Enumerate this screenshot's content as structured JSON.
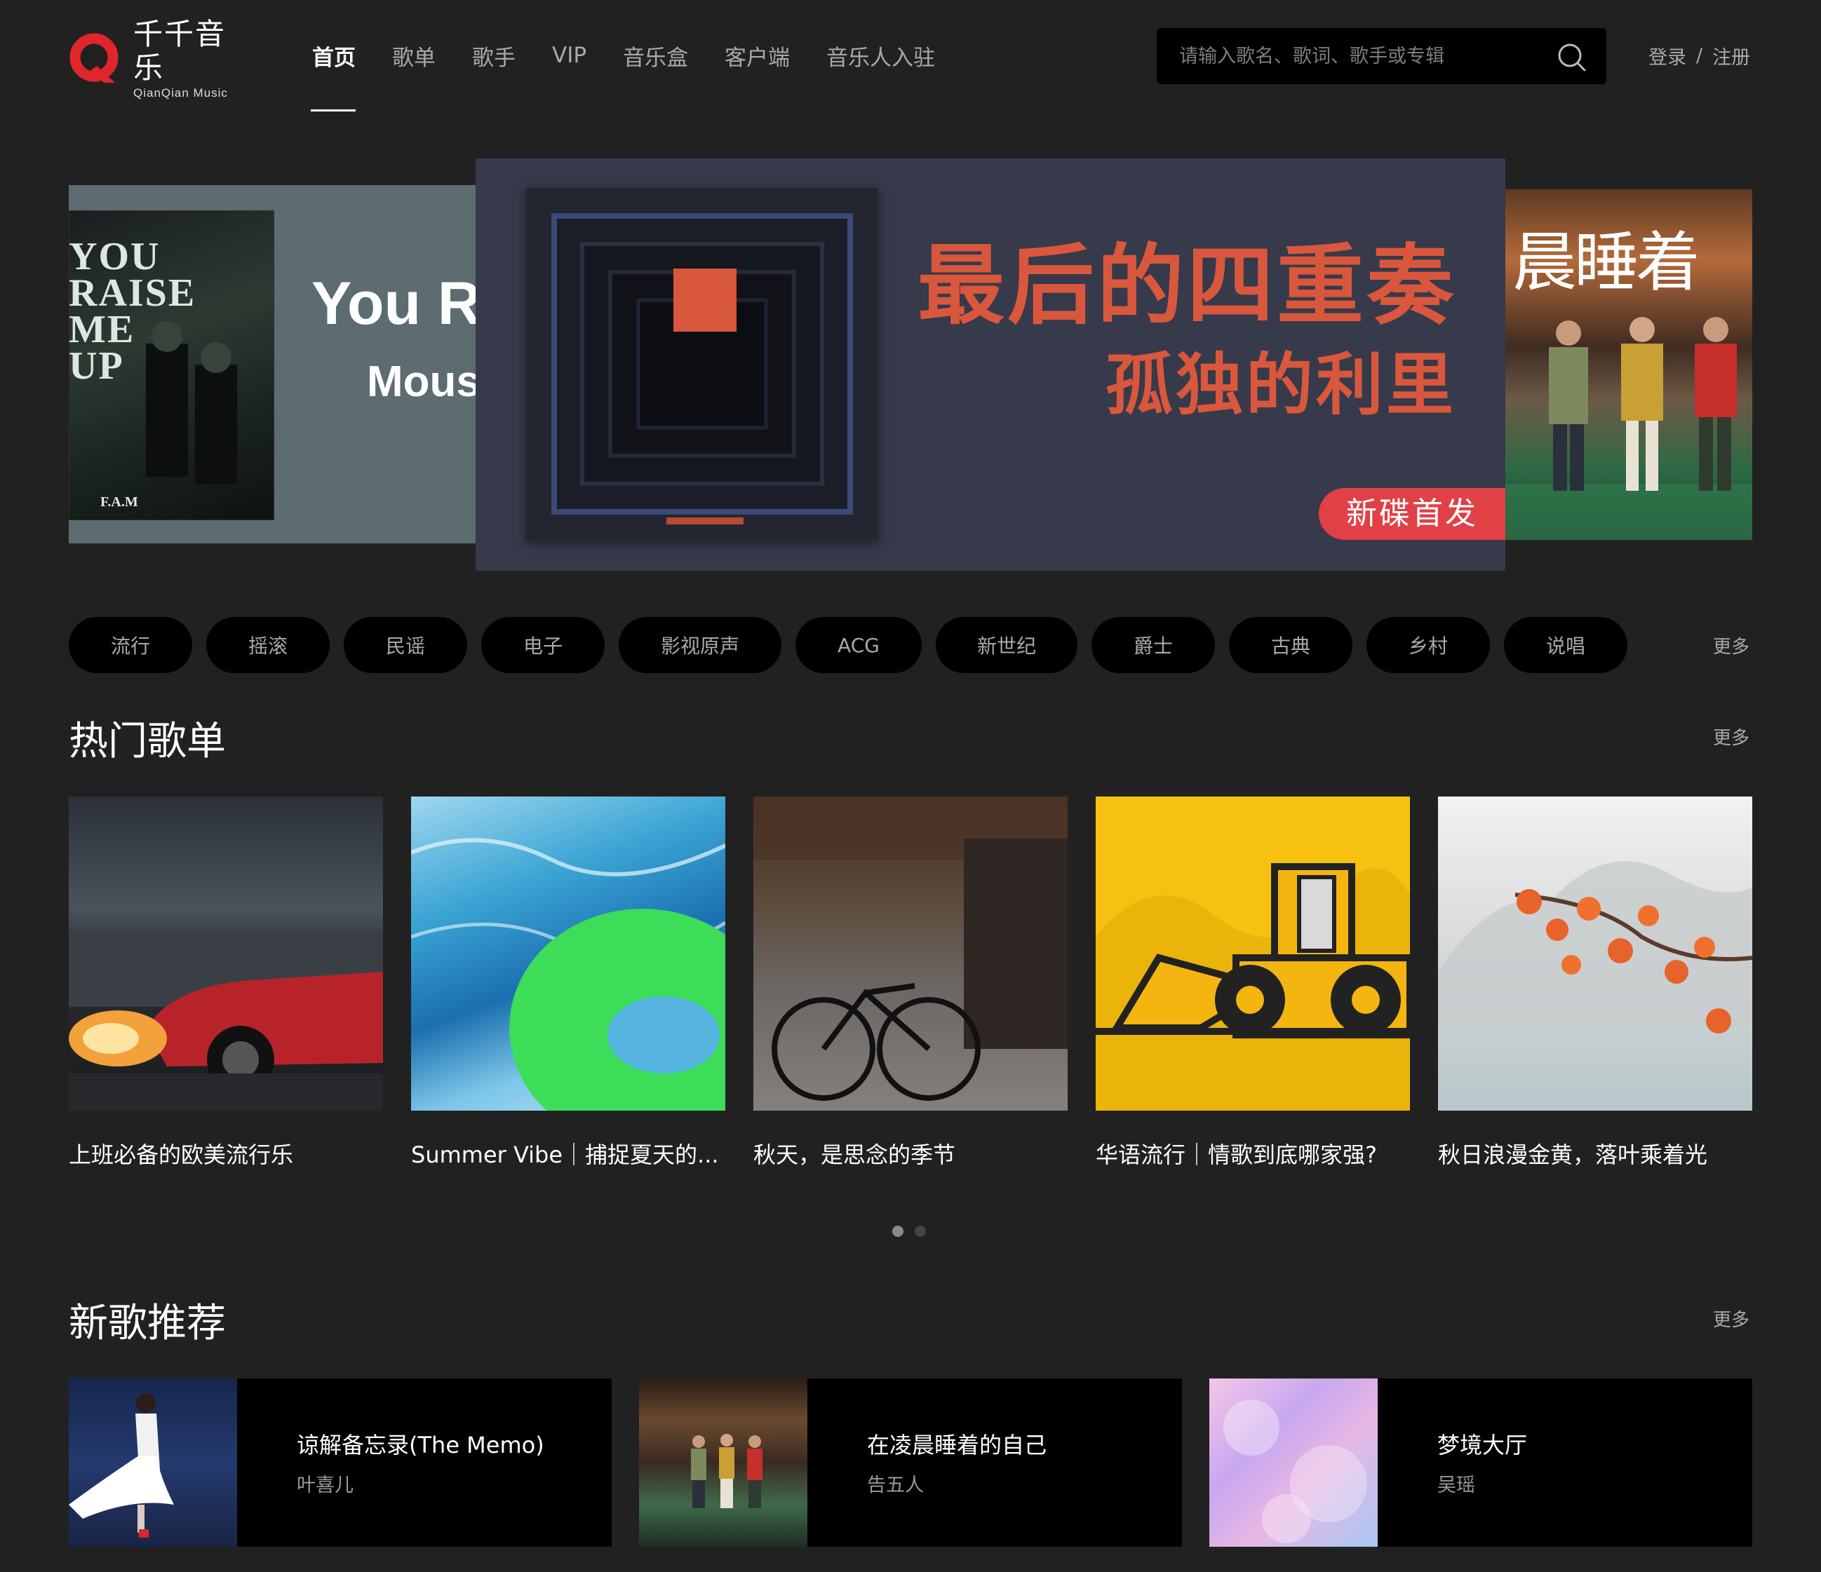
{
  "brand": {
    "name_cn": "千千音乐",
    "name_en": "QianQian Music",
    "accent": "#e0252b"
  },
  "nav": {
    "items": [
      {
        "label": "首页",
        "active": true
      },
      {
        "label": "歌单"
      },
      {
        "label": "歌手"
      },
      {
        "label": "VIP"
      },
      {
        "label": "音乐盒"
      },
      {
        "label": "客户端"
      },
      {
        "label": "音乐人入驻"
      }
    ]
  },
  "search": {
    "placeholder": "请输入歌名、歌词、歌手或专辑",
    "icon": "search-icon"
  },
  "auth": {
    "login": "登录",
    "separator": "/",
    "register": "注册"
  },
  "banner": {
    "left": {
      "title": "You R",
      "subtitle": "Mous",
      "cover_text": "YOU\nRAISE\nME\nUP",
      "cover_label": "F.A.M"
    },
    "center": {
      "title": "最后的四重奏",
      "subtitle": "孤独的利里",
      "badge": "新碟首发",
      "title_color": "#d9573c",
      "badge_color": "#e04046"
    },
    "right": {
      "handwriting": "晨睡着"
    }
  },
  "genres": {
    "items": [
      "流行",
      "摇滚",
      "民谣",
      "电子",
      "影视原声",
      "ACG",
      "新世纪",
      "爵士",
      "古典",
      "乡村",
      "说唱"
    ],
    "more": "更多"
  },
  "hot_playlists": {
    "title": "热门歌单",
    "more": "更多",
    "items": [
      {
        "name": "上班必备的欧美流行乐"
      },
      {
        "name": "Summer Vibe｜捕捉夏天的..."
      },
      {
        "name": "秋天，是思念的季节"
      },
      {
        "name": "华语流行｜情歌到底哪家强?"
      },
      {
        "name": "秋日浪漫金黄，落叶乘着光"
      }
    ],
    "pagination": {
      "pages": 2,
      "current": 1
    }
  },
  "new_songs": {
    "title": "新歌推荐",
    "more": "更多",
    "items": [
      {
        "title": "谅解备忘录(The Memo)",
        "artist": "叶喜儿"
      },
      {
        "title": "在凌晨睡着的自己",
        "artist": "告五人"
      },
      {
        "title": "梦境大厅",
        "artist": "吴瑶"
      }
    ]
  }
}
